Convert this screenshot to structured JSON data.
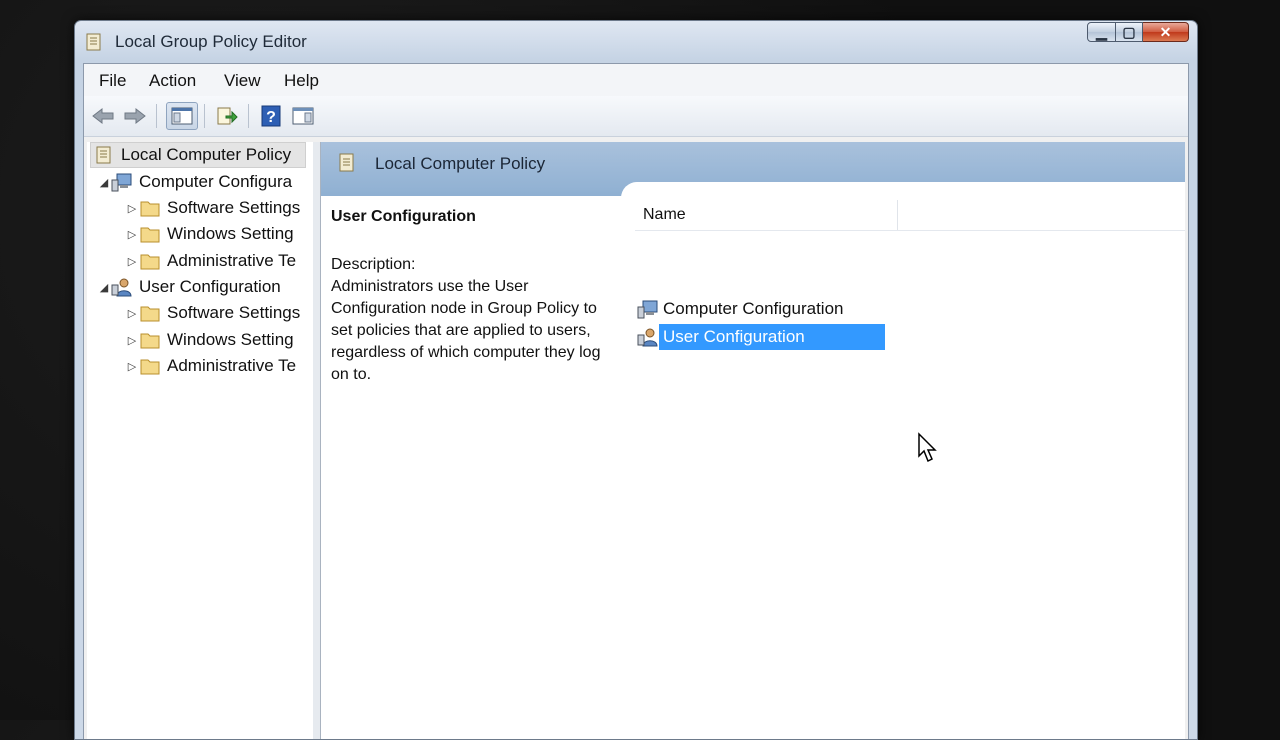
{
  "window": {
    "title": "Local Group Policy Editor"
  },
  "menu": [
    "File",
    "Action",
    "View",
    "Help"
  ],
  "tree": {
    "root": "Local Computer Policy",
    "items": [
      "Computer Configura",
      "Software Settings",
      "Windows Setting",
      "Administrative Te",
      "User Configuration",
      "Software Settings",
      "Windows Setting",
      "Administrative Te"
    ]
  },
  "content": {
    "header_title": "Local Computer Policy",
    "desc_title": "User Configuration",
    "desc_label": "Description:",
    "desc_text": "Administrators use the User Configuration node in Group Policy to set policies that are applied to users, regardless of which computer they log on to.",
    "column_name": "Name",
    "rows": [
      "Computer Configuration",
      "User Configuration"
    ]
  },
  "colors": {
    "selection": "#3399ff",
    "header_band": "#9ab6d6"
  }
}
